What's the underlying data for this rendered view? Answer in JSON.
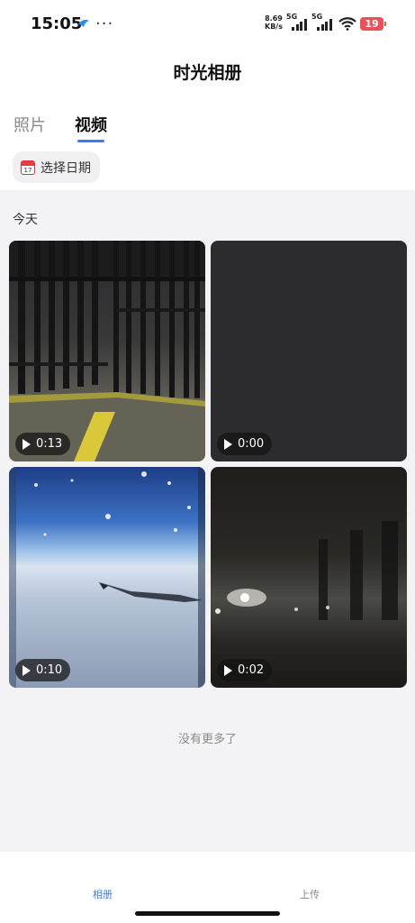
{
  "status_bar": {
    "time": "15:05",
    "dots": "···",
    "speed_value": "8.69",
    "speed_unit": "KB/s",
    "network1": "5G",
    "network2": "5G",
    "battery": "19",
    "battery_color": "#e8505b"
  },
  "header": {
    "title": "时光相册"
  },
  "tabs": [
    {
      "label": "照片",
      "active": false
    },
    {
      "label": "视频",
      "active": true
    }
  ],
  "accent_color": "#3a7cf0",
  "date_picker": {
    "label": "选择日期",
    "icon": "calendar-icon",
    "icon_day": "17"
  },
  "section": {
    "label": "今天"
  },
  "videos": [
    {
      "duration": "0:13",
      "scene": "fence-and-yellow-lines-at-night"
    },
    {
      "duration": "0:00",
      "scene": "blank-dark"
    },
    {
      "duration": "0:10",
      "scene": "airplane-window-clouds"
    },
    {
      "duration": "0:02",
      "scene": "dark-foggy-street-lights"
    }
  ],
  "footer_text": "没有更多了",
  "bottom_nav": [
    {
      "label": "相册",
      "active": true
    },
    {
      "label": "上传",
      "active": false
    }
  ]
}
